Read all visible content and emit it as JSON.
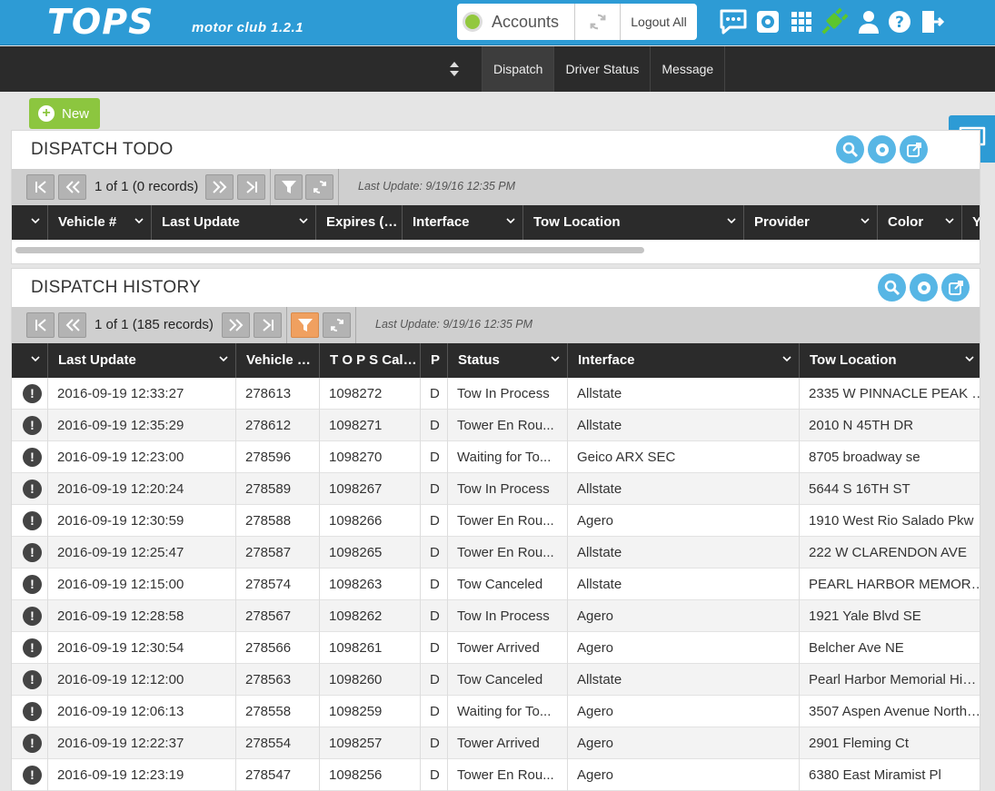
{
  "app": {
    "logo": "TOPS",
    "subtitle": "motor club 1.2.1",
    "accounts_label": "Accounts",
    "logout_label": "Logout All",
    "colors": {
      "brand": "#2d9bd5",
      "nav": "#2b2b2b",
      "new": "#8cc63f",
      "status_ok": "#92c83e",
      "filter_active": "#f0a060"
    }
  },
  "nav": {
    "items": [
      {
        "label": "Dispatch"
      },
      {
        "label": "Driver Status"
      },
      {
        "label": "Message"
      }
    ]
  },
  "new_button": {
    "label": "New"
  },
  "todo": {
    "title": "DISPATCH TODO",
    "pager_text": "1 of 1 (0 records)",
    "last_update": "Last Update: 9/19/16 12:35 PM",
    "columns": [
      "",
      "Vehicle #",
      "Last Update",
      "Expires (…",
      "Interface",
      "Tow Location",
      "Provider",
      "Color",
      "Y"
    ]
  },
  "history": {
    "title": "DISPATCH HISTORY",
    "pager_text": "1 of 1 (185 records)",
    "last_update": "Last Update: 9/19/16 12:35 PM",
    "columns": [
      "",
      "Last Update",
      "Vehicle …",
      "T O P S Cal…",
      "P",
      "Status",
      "Interface",
      "Tow Location"
    ],
    "rows": [
      [
        "2016-09-19 12:33:27",
        "278613",
        "1098272",
        "D",
        "Tow In Process",
        "Allstate",
        "2335 W PINNACLE PEAK …"
      ],
      [
        "2016-09-19 12:35:29",
        "278612",
        "1098271",
        "D",
        "Tower En Rou...",
        "Allstate",
        "2010 N 45TH DR"
      ],
      [
        "2016-09-19 12:23:00",
        "278596",
        "1098270",
        "D",
        "Waiting for To...",
        "Geico ARX SEC",
        "8705 broadway se"
      ],
      [
        "2016-09-19 12:20:24",
        "278589",
        "1098267",
        "D",
        "Tow In Process",
        "Allstate",
        "5644 S 16TH ST"
      ],
      [
        "2016-09-19 12:30:59",
        "278588",
        "1098266",
        "D",
        "Tower En Rou...",
        "Agero",
        "1910 West Rio Salado Pkw"
      ],
      [
        "2016-09-19 12:25:47",
        "278587",
        "1098265",
        "D",
        "Tower En Rou...",
        "Allstate",
        "222 W CLARENDON AVE"
      ],
      [
        "2016-09-19 12:15:00",
        "278574",
        "1098263",
        "D",
        "Tow Canceled",
        "Allstate",
        "PEARL HARBOR MEMOR…"
      ],
      [
        "2016-09-19 12:28:58",
        "278567",
        "1098262",
        "D",
        "Tow In Process",
        "Agero",
        "1921 Yale Blvd SE"
      ],
      [
        "2016-09-19 12:30:54",
        "278566",
        "1098261",
        "D",
        "Tower Arrived",
        "Agero",
        "Belcher Ave NE"
      ],
      [
        "2016-09-19 12:12:00",
        "278563",
        "1098260",
        "D",
        "Tow Canceled",
        "Allstate",
        "Pearl Harbor Memorial Hi…"
      ],
      [
        "2016-09-19 12:06:13",
        "278558",
        "1098259",
        "D",
        "Waiting for To...",
        "Agero",
        "3507 Aspen Avenue North…"
      ],
      [
        "2016-09-19 12:22:37",
        "278554",
        "1098257",
        "D",
        "Tower Arrived",
        "Agero",
        "2901 Fleming Ct"
      ],
      [
        "2016-09-19 12:23:19",
        "278547",
        "1098256",
        "D",
        "Tower En Rou...",
        "Agero",
        "6380 East Miramist Pl"
      ]
    ]
  }
}
